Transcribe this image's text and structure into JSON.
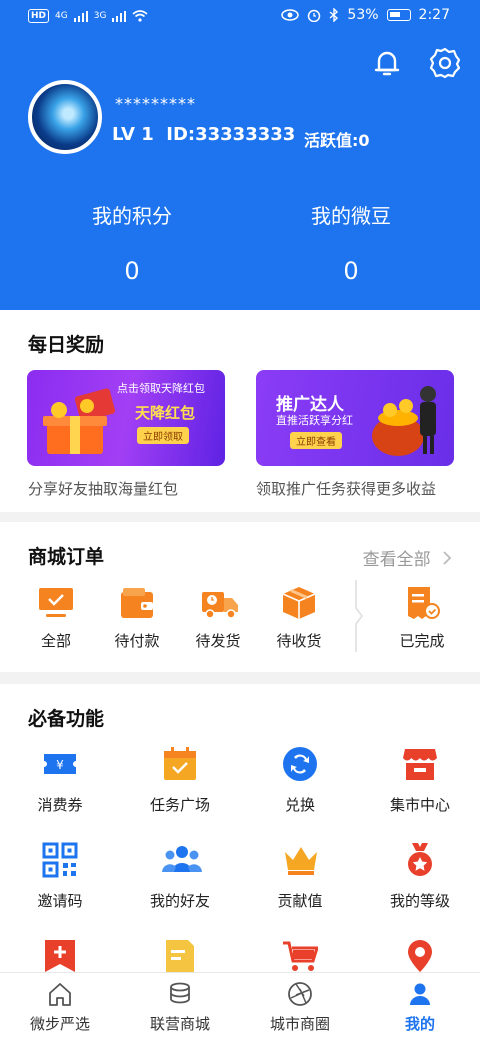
{
  "status_bar": {
    "hd": "HD",
    "sig1": "4G",
    "sig2": "3G",
    "battery": "53%",
    "time": "2:27"
  },
  "header": {
    "masked_name": "*********",
    "level": "LV 1",
    "id_text": "ID:33333333",
    "active": "活跃值:0",
    "stats": [
      {
        "label": "我的积分",
        "value": "0"
      },
      {
        "label": "我的微豆",
        "value": "0"
      }
    ]
  },
  "daily": {
    "title": "每日奖励",
    "banners": [
      {
        "small": "点击领取天降红包",
        "big": "天降红包",
        "btn": "立即领取",
        "caption": "分享好友抽取海量红包"
      },
      {
        "small": "直推活跃享分红",
        "big": "推广达人",
        "btn": "立即查看",
        "caption": "领取推广任务获得更多收益"
      }
    ]
  },
  "orders": {
    "title": "商城订单",
    "view_all": "查看全部",
    "items": [
      {
        "label": "全部",
        "icon": "monitor-icon"
      },
      {
        "label": "待付款",
        "icon": "wallet-icon"
      },
      {
        "label": "待发货",
        "icon": "truck-icon"
      },
      {
        "label": "待收货",
        "icon": "box-icon"
      },
      {
        "label": "已完成",
        "icon": "receipt-check-icon"
      }
    ]
  },
  "features": {
    "title": "必备功能",
    "items": [
      {
        "label": "消费券",
        "icon": "coupon-icon"
      },
      {
        "label": "任务广场",
        "icon": "calendar-check-icon"
      },
      {
        "label": "兑换",
        "icon": "exchange-icon"
      },
      {
        "label": "集市中心",
        "icon": "store-icon"
      },
      {
        "label": "邀请码",
        "icon": "qr-code-icon"
      },
      {
        "label": "我的好友",
        "icon": "friends-icon"
      },
      {
        "label": "贡献值",
        "icon": "crown-icon"
      },
      {
        "label": "我的等级",
        "icon": "medal-icon"
      }
    ]
  },
  "tabs": [
    {
      "label": "微步严选",
      "icon": "home-icon"
    },
    {
      "label": "联营商城",
      "icon": "coins-icon"
    },
    {
      "label": "城市商圈",
      "icon": "aperture-icon"
    },
    {
      "label": "我的",
      "icon": "person-icon"
    }
  ],
  "colors": {
    "primary": "#1d74ee",
    "orange": "#f5831f",
    "red": "#e8402b"
  }
}
